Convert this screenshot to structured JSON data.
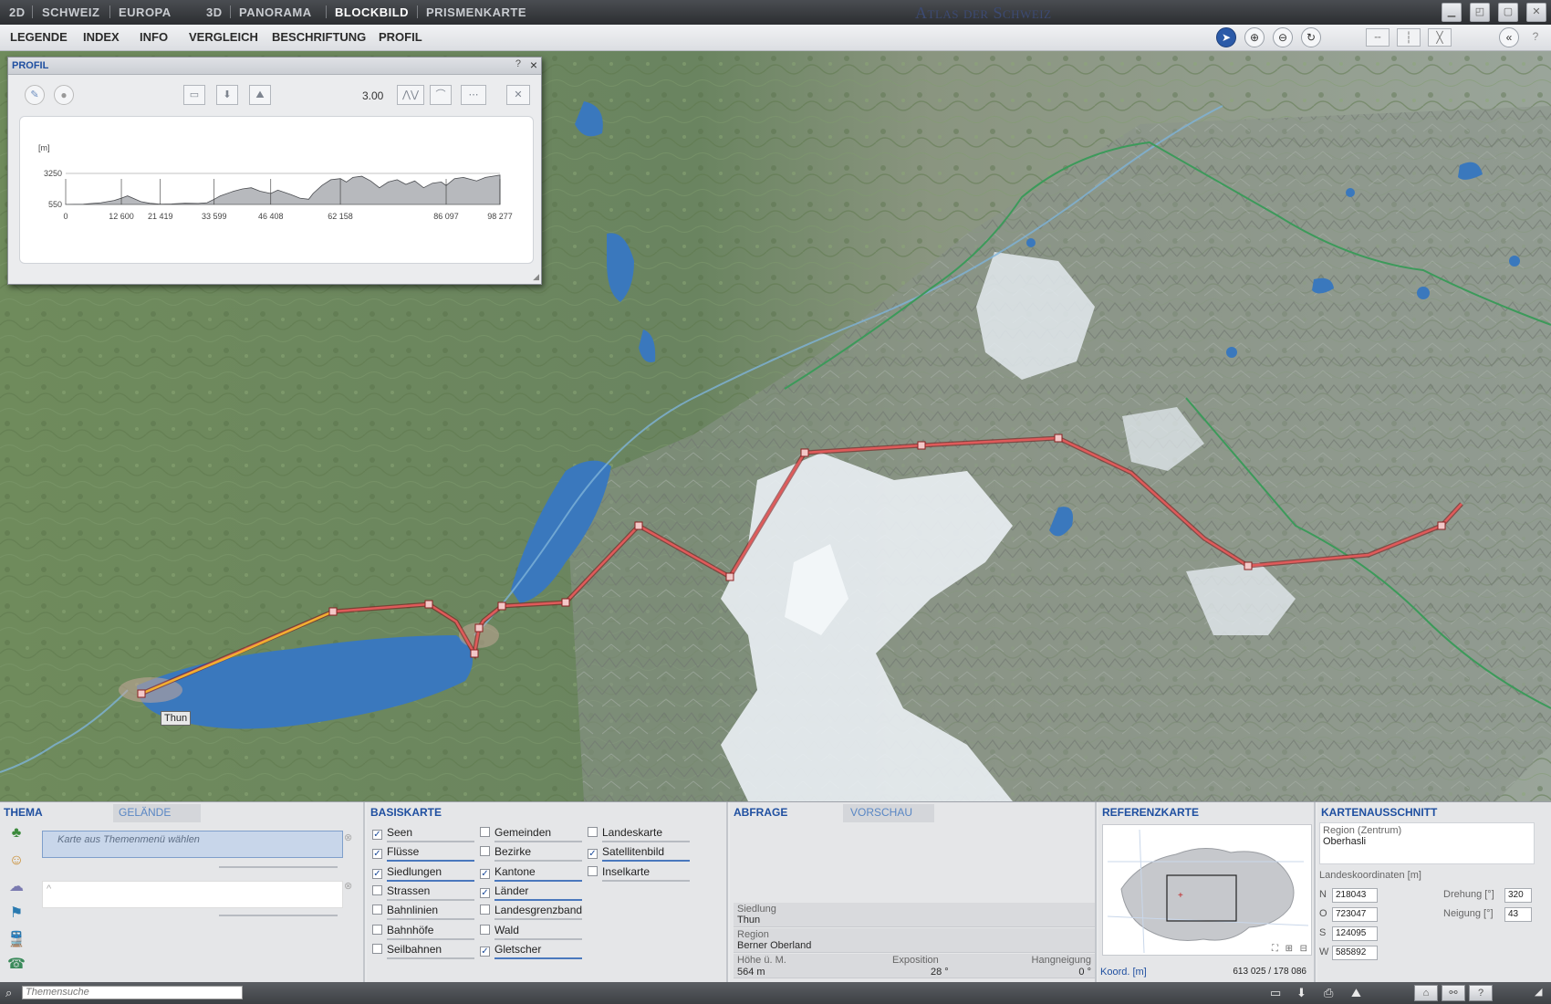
{
  "titlebar": {
    "modes": [
      "2D",
      "SCHWEIZ",
      "EUROPA",
      "3D",
      "PANORAMA",
      "BLOCKBILD",
      "PRISMENKARTE"
    ],
    "active_mode": "BLOCKBILD",
    "app_title": "Atlas der Schweiz"
  },
  "menubar": {
    "items": [
      "LEGENDE",
      "INDEX",
      "INFO",
      "VERGLEICH",
      "BESCHRIFTUNG",
      "PROFIL"
    ]
  },
  "map": {
    "place_label": "Thun",
    "colors": {
      "lake": "#3a78bd",
      "route": "#d53a3a",
      "route_highlight": "#f0b030",
      "glacier": "#e8eef2"
    }
  },
  "profile": {
    "title": "PROFIL",
    "help": "?",
    "close": "×",
    "exaggeration": "3.00",
    "y_unit": "[m]",
    "y_ticks": [
      "3250",
      "550"
    ],
    "x_ticks": [
      "0",
      "12 600",
      "21 419",
      "33 599",
      "46 408",
      "62 158",
      "86 097",
      "98 277"
    ],
    "chart_data": {
      "type": "area",
      "ylabel": "[m]",
      "ylim": [
        550,
        3250
      ],
      "xlim": [
        0,
        98277
      ],
      "x": [
        0,
        4000,
        8000,
        11000,
        12600,
        14000,
        17000,
        19000,
        21419,
        24000,
        27000,
        30000,
        32000,
        33599,
        35000,
        38000,
        40000,
        42000,
        44000,
        46408,
        48000,
        51000,
        53000,
        55000,
        56000,
        58000,
        60000,
        62158,
        63500,
        65000,
        67000,
        69000,
        71000,
        73000,
        75000,
        77000,
        79000,
        81000,
        83000,
        85000,
        86097,
        88000,
        90000,
        93000,
        95000,
        98277
      ],
      "y": [
        560,
        580,
        700,
        900,
        1100,
        1300,
        800,
        650,
        570,
        600,
        650,
        640,
        700,
        1000,
        1300,
        1700,
        1900,
        2000,
        1700,
        1500,
        1800,
        1400,
        1100,
        1000,
        1500,
        2200,
        2700,
        2800,
        2500,
        2900,
        3000,
        2600,
        2000,
        2500,
        2700,
        2300,
        2600,
        2000,
        2400,
        2500,
        2200,
        2800,
        2900,
        2600,
        2900,
        3100
      ]
    }
  },
  "bottom": {
    "thema": {
      "tab": "THEMA",
      "tab2": "GELÄNDE",
      "placeholder": "Karte aus Themenmenü wählen"
    },
    "basiskarte": {
      "tab": "BASISKARTE",
      "col1": [
        {
          "label": "Seen",
          "checked": "✓"
        },
        {
          "label": "Flüsse",
          "checked": "✓"
        },
        {
          "label": "Siedlungen",
          "checked": "✓"
        },
        {
          "label": "Strassen",
          "checked": ""
        },
        {
          "label": "Bahnlinien",
          "checked": ""
        },
        {
          "label": "Bahnhöfe",
          "checked": ""
        },
        {
          "label": "Seilbahnen",
          "checked": ""
        }
      ],
      "col2": [
        {
          "label": "Gemeinden",
          "checked": ""
        },
        {
          "label": "Bezirke",
          "checked": ""
        },
        {
          "label": "Kantone",
          "checked": "✓"
        },
        {
          "label": "Länder",
          "checked": "✓"
        },
        {
          "label": "Landesgrenzband",
          "checked": ""
        },
        {
          "label": "Wald",
          "checked": ""
        },
        {
          "label": "Gletscher",
          "checked": "✓"
        }
      ],
      "col3": [
        {
          "label": "Landeskarte",
          "checked": ""
        },
        {
          "label": "Satellitenbild",
          "checked": "✓"
        },
        {
          "label": "Inselkarte",
          "checked": ""
        }
      ]
    },
    "abfrage": {
      "tab": "ABFRAGE",
      "tab2": "VORSCHAU",
      "siedlung_label": "Siedlung",
      "siedlung": "Thun",
      "region_label": "Region",
      "region": "Berner Oberland",
      "hoehe_label": "Höhe ü. M.",
      "hoehe": "564 m",
      "exposition_label": "Exposition",
      "exposition": "28 °",
      "hangneigung_label": "Hangneigung",
      "hangneigung": "0 °"
    },
    "referenzkarte": {
      "tab": "REFERENZKARTE",
      "koord_label": "Koord. [m]",
      "koord": "613 025 / 178 086"
    },
    "kartenausschnitt": {
      "tab": "KARTENAUSSCHNITT",
      "region_label": "Region (Zentrum)",
      "region": "Oberhasli",
      "landeskoord_label": "Landeskoordinaten [m]",
      "n_label": "N",
      "n": "218043",
      "o_label": "O",
      "o": "723047",
      "s_label": "S",
      "s": "124095",
      "w_label": "W",
      "w": "585892",
      "drehung_label": "Drehung [°]",
      "drehung": "320",
      "neigung_label": "Neigung [°]",
      "neigung": "43"
    }
  },
  "statusbar": {
    "search_placeholder": "Themensuche"
  }
}
